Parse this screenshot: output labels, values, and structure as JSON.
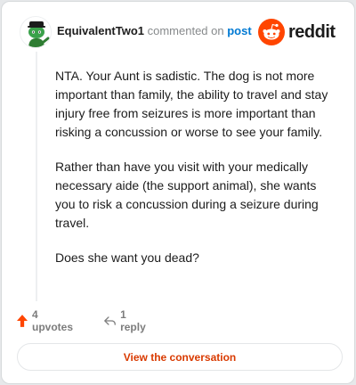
{
  "header": {
    "username": "EquivalentTwo1",
    "verb": " commented on ",
    "link_text": "post",
    "logo_text": "reddit"
  },
  "comment": {
    "paragraphs": [
      "NTA. Your Aunt is sadistic. The dog is not more important than family, the ability to travel and stay injury free from seizures is more important than risking a concussion or worse to see your family.",
      "Rather than have you visit with your medically necessary aide (the support animal), she wants you to risk a concussion during a seizure during travel.",
      "Does she want you dead?"
    ]
  },
  "actions": {
    "upvotes": "4 upvotes",
    "replies": "1 reply"
  },
  "button": {
    "view_label": "View the conversation"
  },
  "colors": {
    "brand": "#ff4500",
    "button_text": "#d93a00",
    "link": "#0079d3"
  },
  "icons": {
    "avatar": "snoo-avatar",
    "logo": "reddit-snoo-icon",
    "upvote": "upvote-arrow-icon",
    "reply": "reply-arrow-icon"
  }
}
